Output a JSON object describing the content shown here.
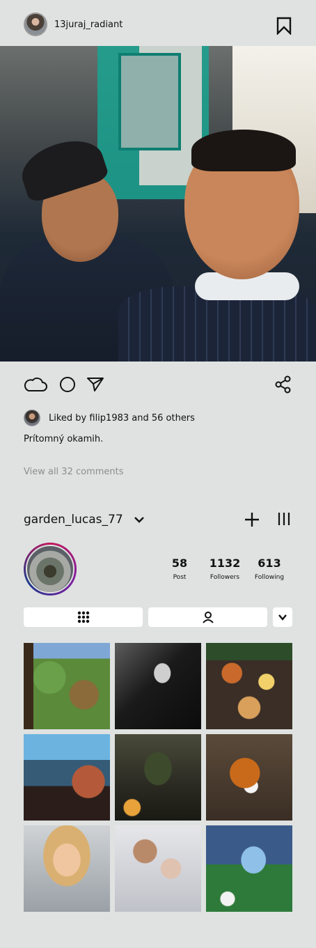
{
  "post": {
    "username": "13juraj_radiant",
    "liked_text": "Liked by filip1983 and 56 others",
    "caption": "Prítomný okamih.",
    "view_comments": "View all 32 comments"
  },
  "profile": {
    "username": "garden_lucas_77",
    "stats": [
      {
        "value": "58",
        "label": "Post"
      },
      {
        "value": "1132",
        "label": "Followers"
      },
      {
        "value": "613",
        "label": "Following"
      }
    ]
  },
  "icons": {
    "bookmark": "bookmark-icon",
    "like": "cloud-icon",
    "comment": "circle-icon",
    "send": "send-icon",
    "share": "share-icon",
    "chevron": "chevron-down-icon",
    "add": "plus-icon",
    "menu": "menu-icon",
    "grid_tab": "grid-icon",
    "tagged_tab": "person-icon"
  },
  "colors": {
    "background": "#dfe2e1",
    "muted_text": "#8d8d8d",
    "avatar_ring": [
      "#c2185b",
      "#7b1fa2",
      "#1e3a8a"
    ]
  }
}
